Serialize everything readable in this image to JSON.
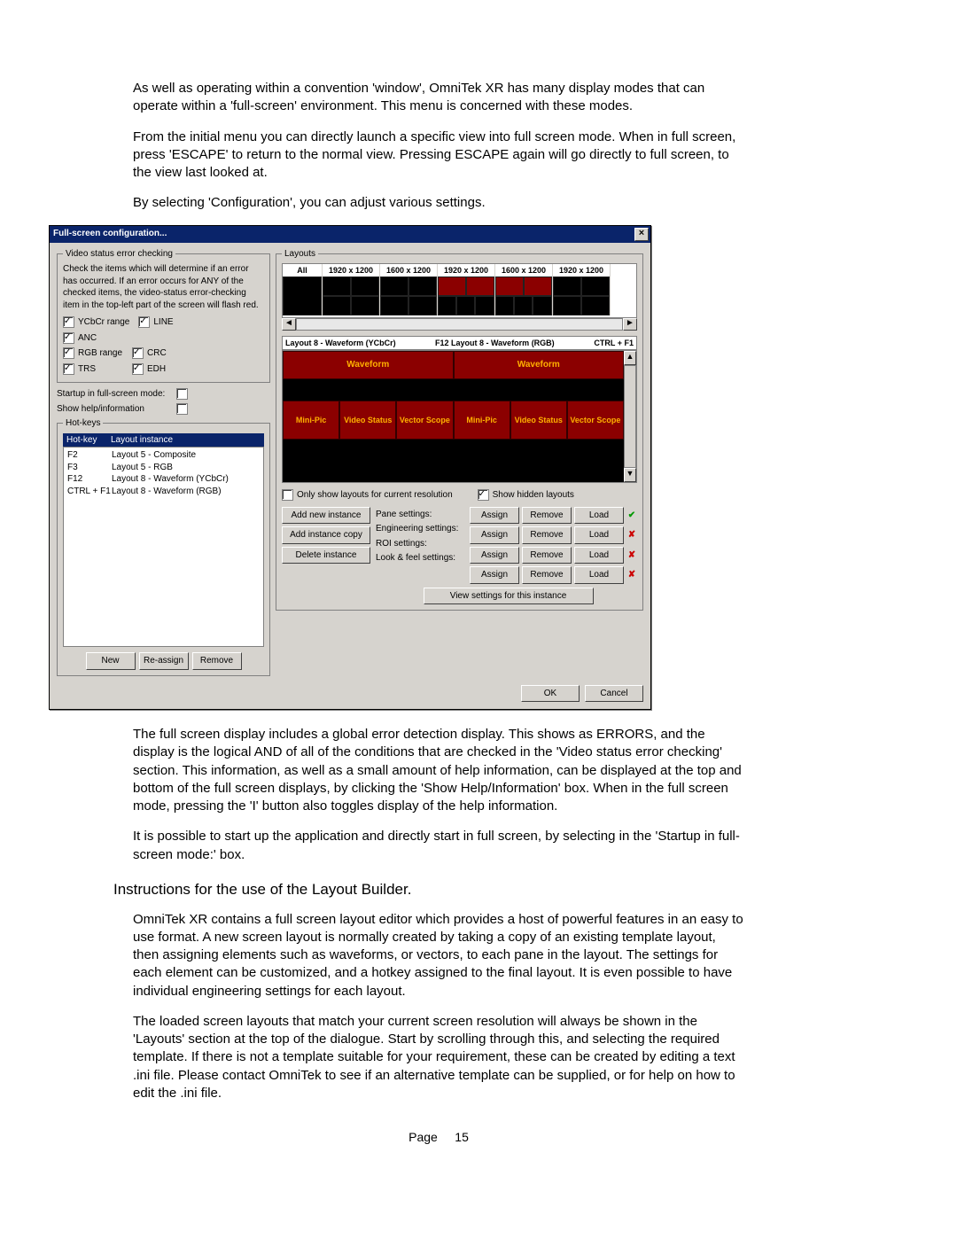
{
  "doc": {
    "p1": "As well as operating within a convention 'window', OmniTek XR has many display modes that can operate within a 'full-screen' environment.  This menu is concerned with these modes.",
    "p2": "From the initial menu you can directly launch a specific view into full screen mode.  When in full screen, press 'ESCAPE' to return to the normal view.  Pressing ESCAPE again will go directly to full screen, to the view last looked at.",
    "p3": "By selecting 'Configuration', you can adjust various settings.",
    "p4": "The full screen display includes a global error detection display.  This shows as ERRORS, and the display is the logical AND of all of the conditions that are checked in the 'Video status error checking' section.  This information, as well as a small amount of help information, can be displayed at the top and bottom of the full screen displays, by clicking the 'Show Help/Information' box.  When in the full screen mode, pressing the 'I' button also toggles display of the help information.",
    "p5": "It is possible to start up the application and directly start in full screen, by selecting in the 'Startup in full-screen mode:' box.",
    "h1": "Instructions for the use of the Layout Builder.",
    "p6": "OmniTek XR contains a full screen layout editor which provides a host of powerful features in an easy to use format.  A new screen layout is normally created by taking a copy of an existing template layout, then assigning elements such as waveforms, or vectors, to each pane in the layout.  The settings for each element can be customized, and a hotkey assigned to the final layout.  It is even possible to have individual engineering settings for each layout.",
    "p7": "The loaded screen layouts that match your current screen resolution will always be shown in the 'Layouts' section at the top of the dialogue.  Start by scrolling through this, and selecting the required template.  If there is not a template suitable for your requirement, these can be created by editing a text .ini file.  Please contact OmniTek to see if an alternative template can be supplied, or for help on how to edit the .ini file.",
    "footer_a": "Page",
    "footer_b": "15"
  },
  "dlg": {
    "title": "Full-screen configuration...",
    "groups": {
      "vsec": "Video status error checking",
      "vsec_desc": "Check the items which will determine if an error has occurred. If an error occurs for ANY of the checked items, the video-status error-checking item in the top-left part of the screen will flash red.",
      "layouts": "Layouts",
      "hotkeys": "Hot-keys"
    },
    "checks": {
      "ycbcr": "YCbCr range",
      "line": "LINE",
      "anc": "ANC",
      "rgb": "RGB range",
      "crc": "CRC",
      "trs": "TRS",
      "edh": "EDH"
    },
    "startup": "Startup in full-screen mode:",
    "showhelp": "Show help/information",
    "hotkey_hdr_a": "Hot-key",
    "hotkey_hdr_b": "Layout instance",
    "hotkeys": [
      {
        "k": "F2",
        "v": "Layout 5 - Composite"
      },
      {
        "k": "F3",
        "v": "Layout 5 - RGB"
      },
      {
        "k": "F12",
        "v": "Layout 8 - Waveform (YCbCr)"
      },
      {
        "k": "CTRL + F1",
        "v": "Layout 8 - Waveform (RGB)"
      }
    ],
    "left_btns": {
      "new": "New",
      "reassign": "Re-assign",
      "remove": "Remove"
    },
    "thumb_hdrs": [
      "All",
      "1920 x 1200",
      "1600 x 1200",
      "1920 x 1200",
      "1600 x 1200",
      "1920 x 1200"
    ],
    "sel_a": "Layout 8 - Waveform (YCbCr)",
    "sel_b": "F12 Layout 8 - Waveform (RGB)",
    "sel_c": "CTRL + F1",
    "panes": {
      "wave": "Waveform",
      "mini": "Mini-Pic",
      "vstat": "Video Status",
      "vscope": "Vector Scope"
    },
    "only_current": "Only show layouts for current resolution",
    "show_hidden": "Show hidden layouts",
    "inst_btns": {
      "add": "Add new instance",
      "copy": "Add instance copy",
      "del": "Delete instance"
    },
    "settings_labels": {
      "pane": "Pane settings:",
      "eng": "Engineering settings:",
      "roi": "ROI settings:",
      "look": "Look & feel settings:"
    },
    "arl": {
      "assign": "Assign",
      "remove": "Remove",
      "load": "Load"
    },
    "view_inst": "View settings for this instance",
    "ok": "OK",
    "cancel": "Cancel"
  }
}
